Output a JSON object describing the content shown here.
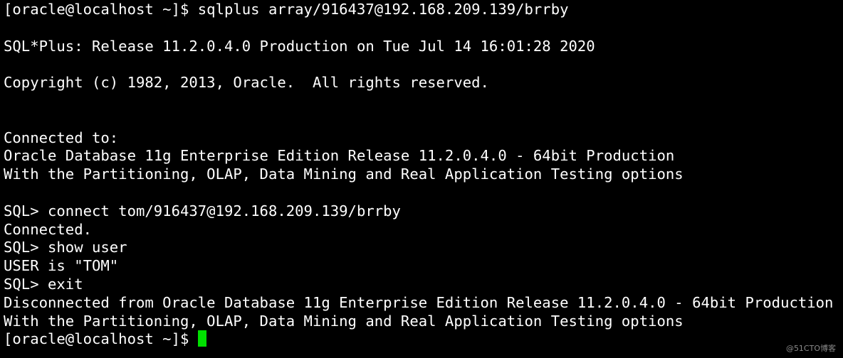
{
  "theme": {
    "background": "#000000",
    "foreground": "#ffffff",
    "cursor_color": "#00e000",
    "watermark_color": "#8a8a8a"
  },
  "terminal": {
    "lines": [
      "[oracle@localhost ~]$ sqlplus array/916437@192.168.209.139/brrby",
      "",
      "SQL*Plus: Release 11.2.0.4.0 Production on Tue Jul 14 16:01:28 2020",
      "",
      "Copyright (c) 1982, 2013, Oracle.  All rights reserved.",
      "",
      "",
      "Connected to:",
      "Oracle Database 11g Enterprise Edition Release 11.2.0.4.0 - 64bit Production",
      "With the Partitioning, OLAP, Data Mining and Real Application Testing options",
      "",
      "SQL> connect tom/916437@192.168.209.139/brrby",
      "Connected.",
      "SQL> show user",
      "USER is \"TOM\"",
      "SQL> exit",
      "Disconnected from Oracle Database 11g Enterprise Edition Release 11.2.0.4.0 - 64bit Production",
      "With the Partitioning, OLAP, Data Mining and Real Application Testing options"
    ],
    "prompt": "[oracle@localhost ~]$ "
  },
  "watermark": "@51CTO博客"
}
